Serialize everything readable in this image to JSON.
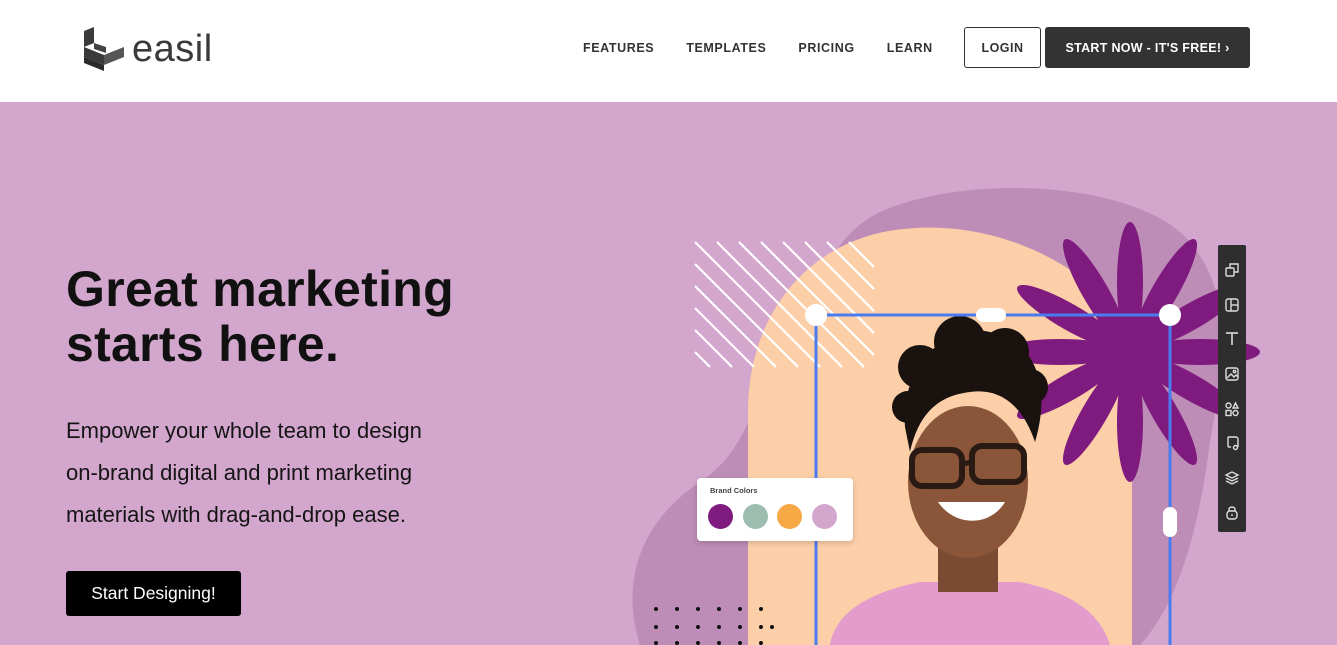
{
  "header": {
    "logo_text": "easil",
    "nav": [
      "FEATURES",
      "TEMPLATES",
      "PRICING",
      "LEARN"
    ],
    "login_label": "LOGIN",
    "start_label": "START NOW - IT'S FREE! ›"
  },
  "hero": {
    "headline_line1": "Great marketing",
    "headline_line2": "starts here.",
    "sub_line1": "Empower your whole team to design",
    "sub_line2": "on-brand digital and print marketing",
    "sub_line3": "materials with drag-and-drop ease.",
    "cta_label": "Start Designing!"
  },
  "brand_colors": {
    "title": "Brand Colors",
    "swatches": [
      "#7f1a7f",
      "#9cbdb0",
      "#f6a845",
      "#d3a6cd"
    ]
  },
  "toolbar_icons": [
    "resize-icon",
    "layout-icon",
    "text-icon",
    "image-icon",
    "shapes-icon",
    "music-icon",
    "layers-icon",
    "lock-icon"
  ],
  "colors": {
    "hero_bg": "#d3a6cd",
    "dark": "#333333",
    "frame_blue": "#4a7cf0",
    "peach": "#fccfa9",
    "flower": "#7f1a7f"
  }
}
